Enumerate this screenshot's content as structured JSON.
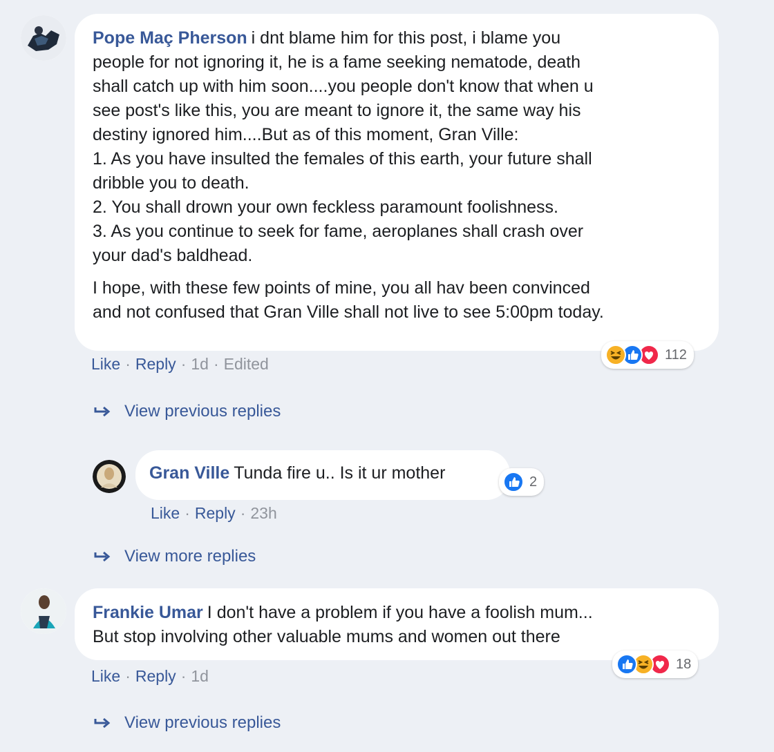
{
  "comments": [
    {
      "author": "Pope Maç Pherson",
      "lines": [
        "i dnt blame him for this post, i blame you",
        "people for not ignoring it, he is a fame seeking nematode, death",
        "shall catch up with him soon....you people don't know that when u",
        "see post's like this, you are meant to ignore it, the same way his",
        "destiny ignored him....But as of this moment, Gran Ville:",
        "1. As you have insulted the females of this earth, your future shall",
        "dribble you to death.",
        "2. You shall drown your own feckless paramount foolishness.",
        "3. As you continue to seek for fame, aeroplanes shall crash over",
        "your dad's baldhead."
      ],
      "paragraph2": [
        "I hope, with these few points of mine, you all hav been convinced",
        "and not confused that Gran Ville shall not live to see 5:00pm today."
      ],
      "actions": {
        "like": "Like",
        "reply": "Reply",
        "time": "1d",
        "edited": "Edited"
      },
      "reaction_icons": [
        "haha-icon",
        "like-icon",
        "love-icon"
      ],
      "reaction_count": "112"
    },
    {
      "author": "Gran Ville",
      "lines": [
        "Tunda fire u.. Is it ur mother"
      ],
      "actions": {
        "like": "Like",
        "reply": "Reply",
        "time": "23h"
      },
      "reaction_icons": [
        "like-icon"
      ],
      "reaction_count": "2"
    },
    {
      "author": "Frankie Umar",
      "lines": [
        "I don't have a problem if you have a foolish mum...",
        "But stop involving other valuable mums and women out there"
      ],
      "actions": {
        "like": "Like",
        "reply": "Reply",
        "time": "1d"
      },
      "reaction_icons": [
        "like-icon",
        "haha-icon",
        "love-icon"
      ],
      "reaction_count": "18"
    }
  ],
  "links": {
    "view_previous_1": "View previous replies",
    "view_more": "View more replies",
    "view_previous_2": "View previous replies"
  },
  "colors": {
    "page_bg": "#edf0f5",
    "bubble_bg": "#ffffff",
    "author": "#385898",
    "link": "#385898",
    "muted": "#90949c",
    "like_blue": "#1877f2",
    "love_red": "#f0284a",
    "haha_yellow": "#f7b125"
  }
}
